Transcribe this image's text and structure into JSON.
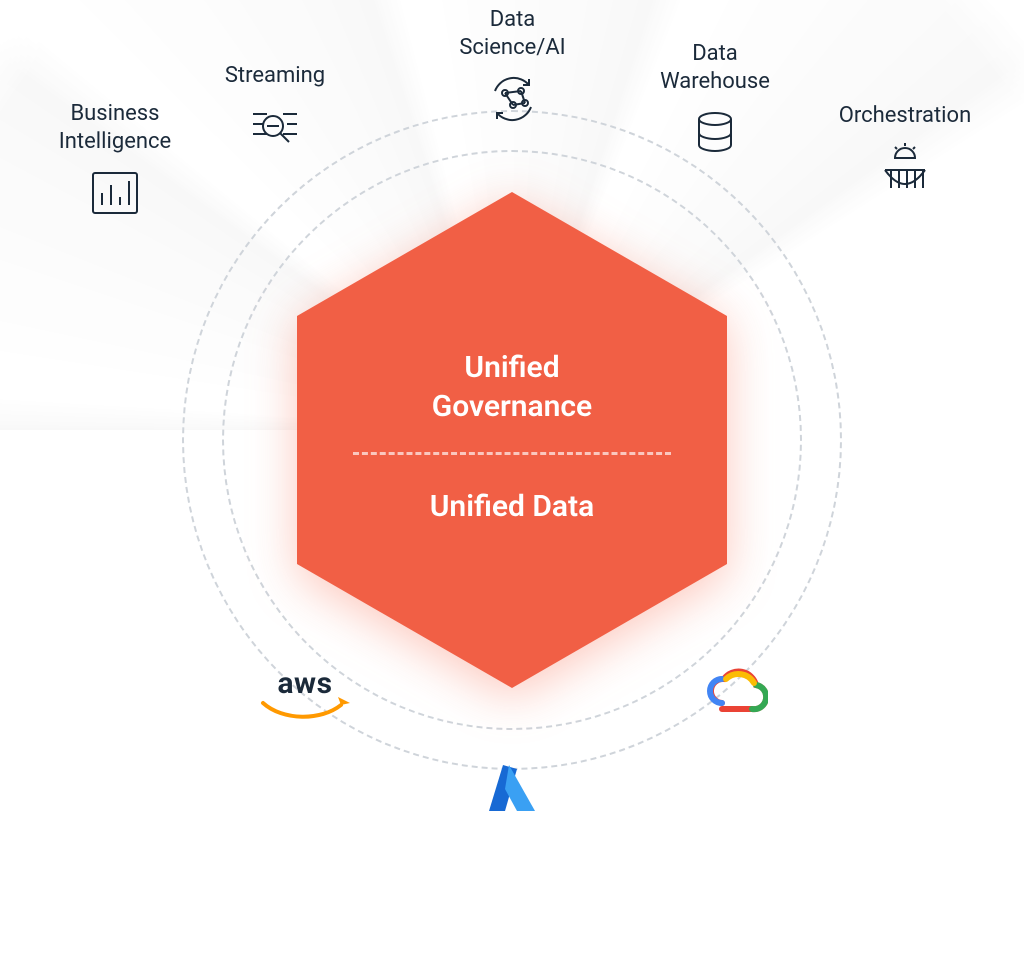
{
  "capabilities": {
    "bi": {
      "label": "Business\nIntelligence",
      "icon": "bar-chart-icon"
    },
    "str": {
      "label": "Streaming",
      "icon": "stream-search-icon"
    },
    "ds": {
      "label": "Data\nScience/AI",
      "icon": "network-cycle-icon"
    },
    "dw": {
      "label": "Data\nWarehouse",
      "icon": "database-icon"
    },
    "orc": {
      "label": "Orchestration",
      "icon": "gear-bridge-icon"
    }
  },
  "center": {
    "top": "Unified\nGovernance",
    "bottom": "Unified Data"
  },
  "providers": {
    "aws": "aws",
    "azure": "Azure",
    "gcp": "Google Cloud"
  },
  "colors": {
    "hex": "#f15f45",
    "text": "#1b2a3a",
    "dash": "#cfd4da"
  }
}
